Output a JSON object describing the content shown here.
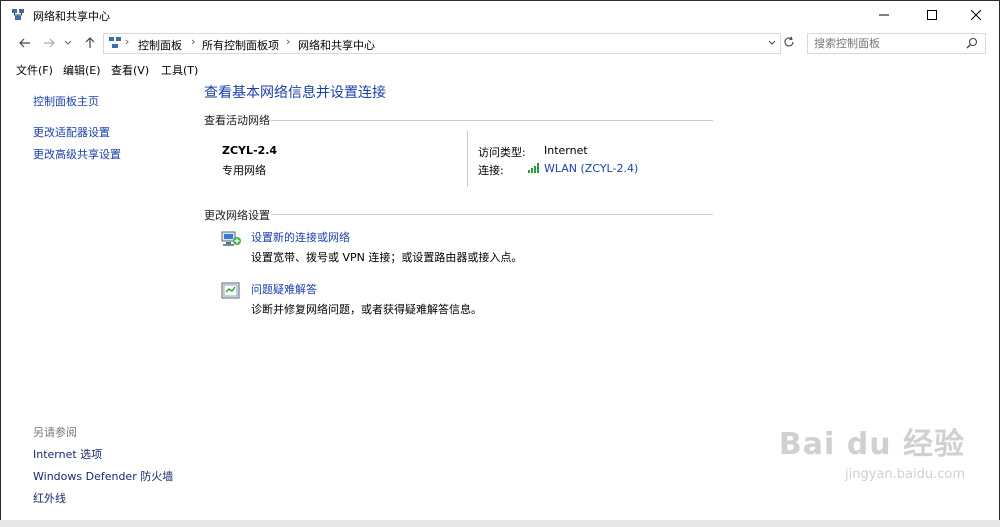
{
  "window": {
    "title": "网络和共享中心"
  },
  "address_bar": {
    "breadcrumbs": [
      "控制面板",
      "所有控制面板项",
      "网络和共享中心"
    ],
    "search_placeholder": "搜索控制面板"
  },
  "menu": {
    "items": [
      "文件(F)",
      "编辑(E)",
      "查看(V)",
      "工具(T)"
    ]
  },
  "sidebar": {
    "home": "控制面板主页",
    "links": [
      "更改适配器设置",
      "更改高级共享设置"
    ],
    "see_also_heading": "另请参阅",
    "see_also": [
      "Internet 选项",
      "Windows Defender 防火墙",
      "红外线"
    ]
  },
  "main": {
    "title": "查看基本网络信息并设置连接",
    "active_networks_heading": "查看活动网络",
    "network": {
      "name": "ZCYL-2.4",
      "type": "专用网络",
      "access_type_label": "访问类型:",
      "access_type_value": "Internet",
      "connection_label": "连接:",
      "connection_value": "WLAN (ZCYL-2.4)"
    },
    "change_settings_heading": "更改网络设置",
    "tasks": [
      {
        "link": "设置新的连接或网络",
        "desc": "设置宽带、拨号或 VPN 连接；或设置路由器或接入点。"
      },
      {
        "link": "问题疑难解答",
        "desc": "诊断并修复网络问题，或者获得疑难解答信息。"
      }
    ]
  },
  "watermark": {
    "brand": "Bai du 经验",
    "url": "jingyan.baidu.com"
  },
  "colors": {
    "link": "#1c3faa",
    "signal": "#2e9e3c"
  }
}
